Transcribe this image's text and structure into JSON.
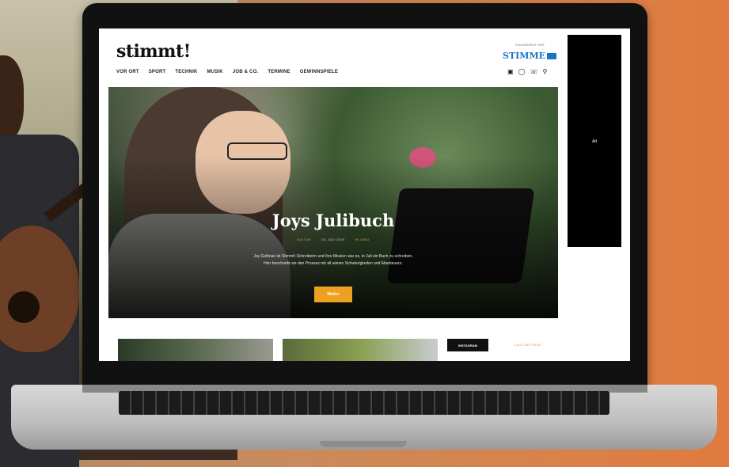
{
  "site": {
    "logo_text": "stimmt!",
    "nav": [
      "VOR ORT",
      "SPORT",
      "TECHNIK",
      "MUSIK",
      "JOB & CO.",
      "TERMINE",
      "GEWINNSPIELE"
    ],
    "partner_label": "EIN ANGEBOT DER",
    "partner_logo": "STIMME"
  },
  "hero": {
    "title": "Joys Julibuch",
    "meta_category": "KULTUR",
    "meta_date": "02. JULI 2019",
    "meta_author": "IN JUNG",
    "text_line1": "Joy Gollman ist Stimmt!-Schreiberin und Ihre Mission war es, in Juli ein Buch zu schreiben.",
    "text_line2": "Hier beschreibt sie den Prozess mit all seinen Schwierigkeiten und Abenteuern.",
    "button_label": "Weiter"
  },
  "ad": {
    "label": "Ad"
  },
  "footer": {
    "instagram_label": "INSTAGRAM",
    "more_label": "> ALLE BEITRÄGE"
  },
  "icons": [
    "facebook-icon",
    "instagram-icon",
    "whatsapp-icon",
    "search-icon"
  ]
}
